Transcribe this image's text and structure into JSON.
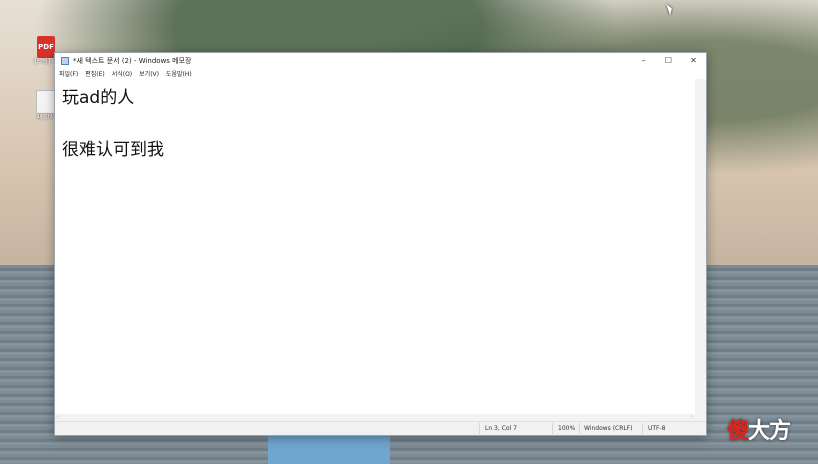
{
  "desktop": {
    "icons": [
      {
        "kind": "pdf",
        "glyph": "PDF",
        "label": "[드링]\n가"
      },
      {
        "kind": "txt",
        "glyph": "",
        "label": "새 \n고사"
      }
    ]
  },
  "window": {
    "title": "*새 텍스트 문서 (2) - Windows 메모장",
    "controls": {
      "minimize": "–",
      "maximize": "☐",
      "close": "✕"
    },
    "menu": [
      "파일(F)",
      "편집(E)",
      "서식(O)",
      "보기(V)",
      "도움말(H)"
    ],
    "content": {
      "lines": [
        "玩ad的人",
        "",
        "很难认可到我"
      ]
    },
    "scrollbar": {
      "left_arrow": "‹",
      "right_arrow": "›"
    },
    "status": {
      "position": "Ln 3, Col 7",
      "zoom": "100%",
      "line_ending": "Windows (CRLF)",
      "encoding": "UTF-8"
    }
  },
  "watermark": {
    "part1": "傻",
    "part2": "大方"
  }
}
